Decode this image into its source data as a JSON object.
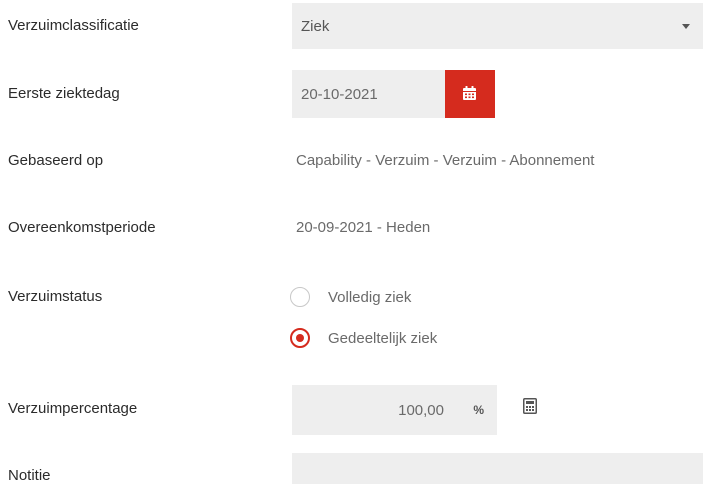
{
  "form": {
    "absence_classification": {
      "label": "Verzuimclassificatie",
      "value": "Ziek",
      "icon": "chevron-down-icon"
    },
    "first_sick_day": {
      "label": "Eerste ziektedag",
      "value": "20-10-2021",
      "icon": "calendar-icon",
      "icon_color": "#d52b1e"
    },
    "based_on": {
      "label": "Gebaseerd op",
      "value": "Capability - Verzuim - Verzuim - Abonnement"
    },
    "agreement_period": {
      "label": "Overeenkomstperiode",
      "value": "20-09-2021 - Heden"
    },
    "absence_status": {
      "label": "Verzuimstatus",
      "options": [
        {
          "label": "Volledig ziek",
          "selected": false
        },
        {
          "label": "Gedeeltelijk ziek",
          "selected": true
        }
      ]
    },
    "absence_percentage": {
      "label": "Verzuimpercentage",
      "value": "100,00",
      "unit": "%",
      "icon": "calculator-icon"
    },
    "note": {
      "label": "Notitie",
      "value": ""
    }
  },
  "colors": {
    "accent": "#d52b1e",
    "field_background": "#eeeeee",
    "label_text": "#2b2b2b",
    "value_text": "#6a6a6a"
  }
}
